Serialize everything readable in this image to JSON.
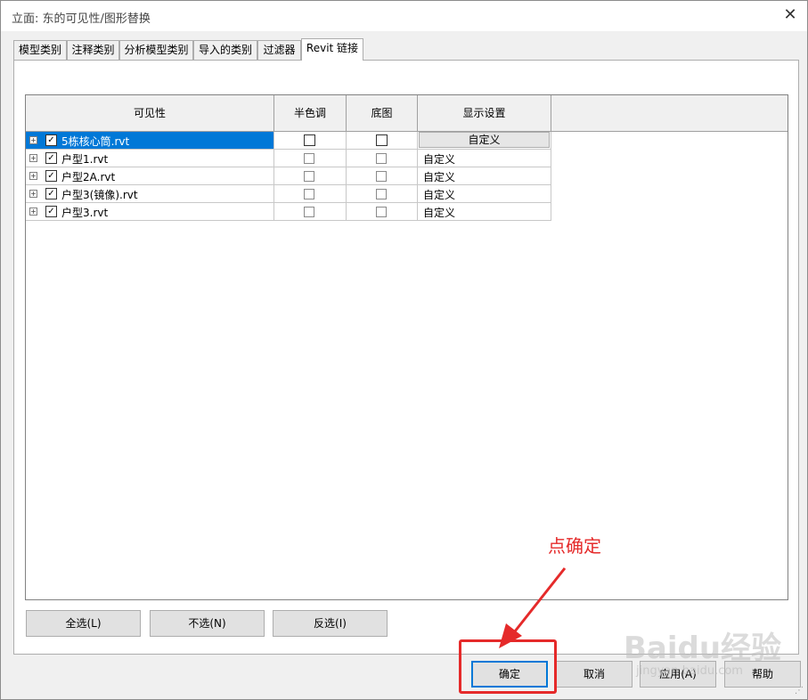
{
  "window": {
    "title": "立面: 东的可见性/图形替换",
    "close_glyph": "✕"
  },
  "tabs": [
    {
      "label": "模型类别"
    },
    {
      "label": "注释类别"
    },
    {
      "label": "分析模型类别"
    },
    {
      "label": "导入的类别"
    },
    {
      "label": "过滤器"
    },
    {
      "label": "Revit 链接"
    }
  ],
  "grid": {
    "columns": [
      "可见性",
      "半色调",
      "底图",
      "显示设置"
    ],
    "rows": [
      {
        "name": "5栋核心筒.rvt",
        "visible": true,
        "halftone": false,
        "underlay": false,
        "display": "自定义",
        "selected": true
      },
      {
        "name": "户型1.rvt",
        "visible": true,
        "halftone": false,
        "underlay": false,
        "display": "自定义",
        "selected": false
      },
      {
        "name": "户型2A.rvt",
        "visible": true,
        "halftone": false,
        "underlay": false,
        "display": "自定义",
        "selected": false
      },
      {
        "name": "户型3(镜像).rvt",
        "visible": true,
        "halftone": false,
        "underlay": false,
        "display": "自定义",
        "selected": false
      },
      {
        "name": "户型3.rvt",
        "visible": true,
        "halftone": false,
        "underlay": false,
        "display": "自定义",
        "selected": false
      }
    ]
  },
  "buttons": {
    "select_all": "全选(L)",
    "select_none": "不选(N)",
    "invert": "反选(I)",
    "ok": "确定",
    "cancel": "取消",
    "apply": "应用(A)",
    "help": "帮助"
  },
  "annotation": {
    "text": "点确定",
    "color": "#e52a2a"
  },
  "watermark": {
    "text": "Baidu经验",
    "sub": "jingyan.baidu.com"
  },
  "colors": {
    "selection": "#0078d7",
    "annotation": "#e52a2a"
  }
}
